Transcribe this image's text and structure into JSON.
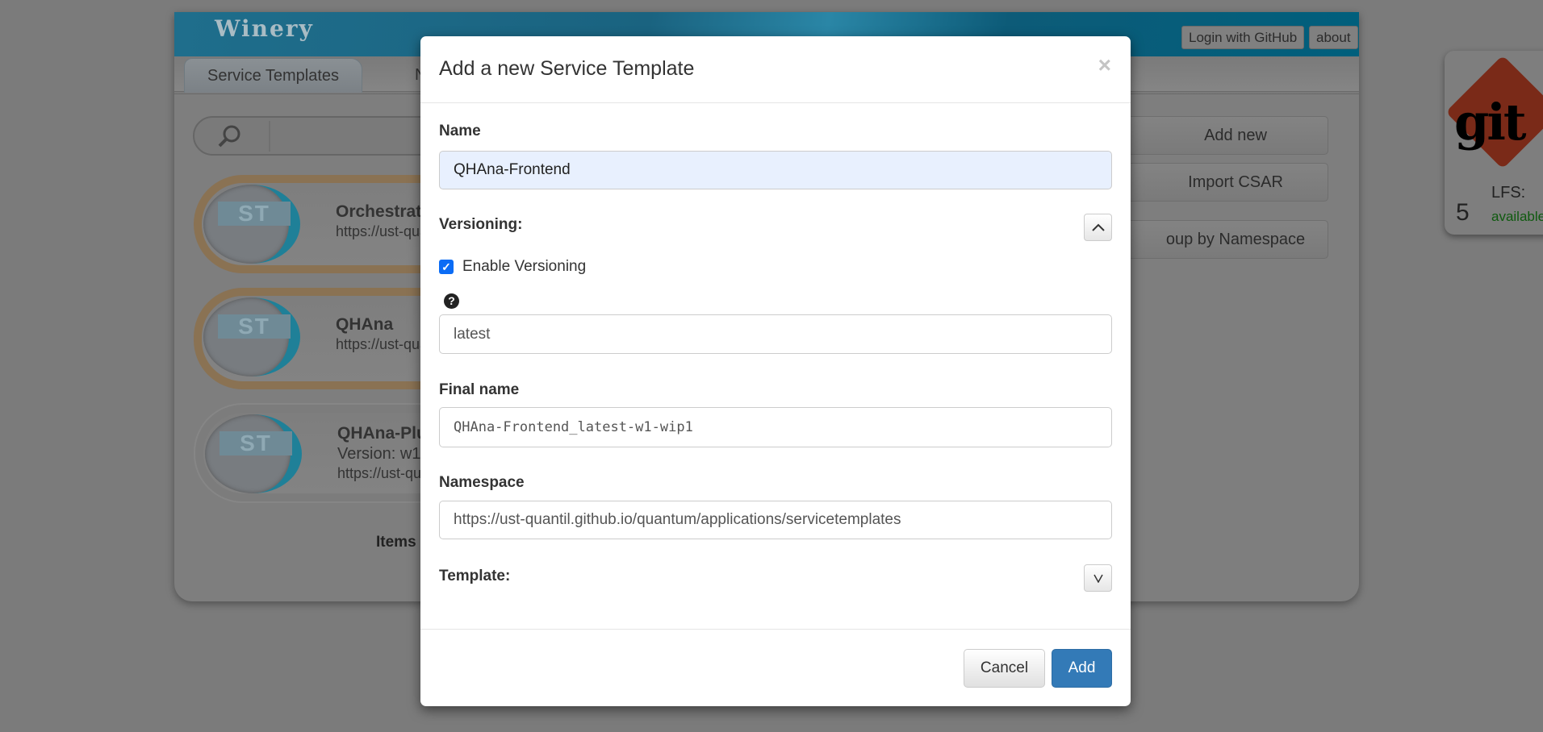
{
  "app": {
    "logo": "Winery",
    "login_label": "Login with GitHub",
    "about_label": "about"
  },
  "tabs": [
    {
      "label": "Service Templates"
    },
    {
      "label": "No"
    }
  ],
  "sidebar_buttons": {
    "add_new": "Add new",
    "import_csar": "Import CSAR",
    "group_by_namespace": "oup by Namespace"
  },
  "cards": [
    {
      "title": "Orchestrat",
      "namespace": "https://ust-qua"
    },
    {
      "title": "QHAna",
      "namespace": "https://ust-qua"
    },
    {
      "title": "QHAna-Plu",
      "version": "Version: w1",
      "namespace": "https://ust-qua"
    }
  ],
  "items_label": "Items",
  "git": {
    "logo_text": "git",
    "count": "5",
    "lfs_label": "LFS:",
    "lfs_status": "available"
  },
  "modal": {
    "title": "Add a new Service Template",
    "close": "×",
    "name_label": "Name",
    "name_value": "QHAna-Frontend",
    "versioning_label": "Versioning:",
    "enable_versioning_label": "Enable Versioning",
    "help_icon": "?",
    "version_value": "latest",
    "final_name_label": "Final name",
    "final_name_value": "QHAna-Frontend_latest-w1-wip1",
    "namespace_label": "Namespace",
    "namespace_value": "https://ust-quantil.github.io/quantum/applications/servicetemplates",
    "template_label": "Template:",
    "cancel_label": "Cancel",
    "add_label": "Add"
  }
}
